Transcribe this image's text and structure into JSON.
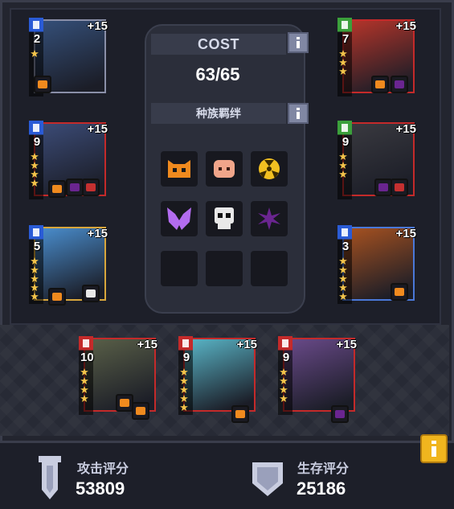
{
  "center_panel": {
    "cost_title": "COST",
    "cost_value": "63/65",
    "synergy_title": "种族羁绊",
    "info_label": "i"
  },
  "traits": [
    {
      "icon": "orange-cat-face-icon",
      "color": "#f08a1e",
      "active": true
    },
    {
      "icon": "peach-face-icon",
      "color": "#f0a58a",
      "active": true
    },
    {
      "icon": "yellow-radiation-icon",
      "color": "#f2c021",
      "active": true
    },
    {
      "icon": "purple-wings-icon",
      "color": "#b36cf0",
      "active": true
    },
    {
      "icon": "white-skull-icon",
      "color": "#e8e8e8",
      "active": true
    },
    {
      "icon": "dark-purple-spark-icon",
      "color": "#6a2590",
      "active": true
    },
    {
      "icon": "empty-slot",
      "color": "#17181f",
      "active": false
    },
    {
      "icon": "empty-slot",
      "color": "#17181f",
      "active": false
    },
    {
      "icon": "empty-slot",
      "color": "#17181f",
      "active": false
    }
  ],
  "heroes": [
    {
      "level": "2",
      "plus": "+15",
      "stars": 1,
      "role": "mage",
      "frame": "#8a8fa8",
      "tag": "#2a5bd6",
      "art": "#35507a"
    },
    {
      "level": "9",
      "plus": "+15",
      "stars": 4,
      "role": "mage",
      "frame": "#c42a2a",
      "tag": "#2a5bd6",
      "art": "#3c4c78"
    },
    {
      "level": "5",
      "plus": "+15",
      "stars": 5,
      "role": "mage",
      "frame": "#d8a63c",
      "tag": "#2a5bd6",
      "art": "#4a8fd0"
    },
    {
      "level": "7",
      "plus": "+15",
      "stars": 3,
      "role": "support",
      "frame": "#c42a2a",
      "tag": "#3ba03b",
      "art": "#b8352a"
    },
    {
      "level": "9",
      "plus": "+15",
      "stars": 3,
      "role": "support",
      "frame": "#c42a2a",
      "tag": "#3ba03b",
      "art": "#3a3a40"
    },
    {
      "level": "3",
      "plus": "+15",
      "stars": 5,
      "role": "mage",
      "frame": "#4a78d8",
      "tag": "#2a5bd6",
      "art": "#a85220"
    },
    {
      "level": "10",
      "plus": "+15",
      "stars": 4,
      "role": "warrior",
      "frame": "#c42a2a",
      "tag": "#c42a2a",
      "art": "#5a6048"
    },
    {
      "level": "9",
      "plus": "+15",
      "stars": 5,
      "role": "warrior",
      "frame": "#c42a2a",
      "tag": "#c42a2a",
      "art": "#5ab6c8"
    },
    {
      "level": "9",
      "plus": "+15",
      "stars": 4,
      "role": "warrior",
      "frame": "#c42a2a",
      "tag": "#c42a2a",
      "art": "#6a4a8a"
    }
  ],
  "stats": {
    "attack_label": "攻击评分",
    "attack_value": "53809",
    "survival_label": "生存评分",
    "survival_value": "25186"
  }
}
